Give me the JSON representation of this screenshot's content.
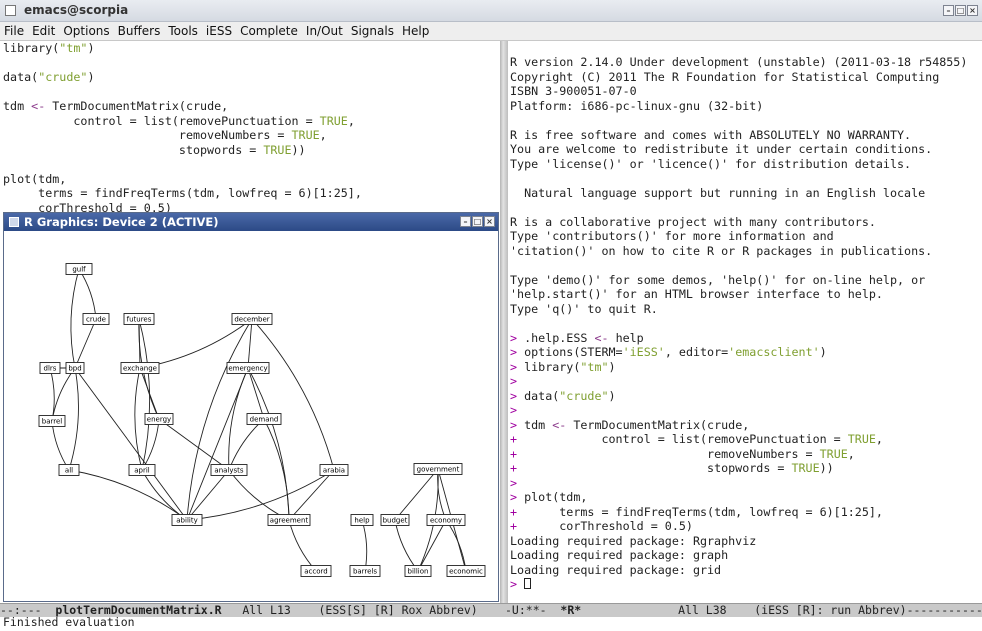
{
  "window": {
    "title": "emacs@scorpia"
  },
  "menu": [
    "File",
    "Edit",
    "Options",
    "Buffers",
    "Tools",
    "iESS",
    "Complete",
    "In/Out",
    "Signals",
    "Help"
  ],
  "editor": {
    "lines": [
      [
        [
          "library(",
          ""
        ],
        [
          "\"tm\"",
          "str"
        ],
        [
          ")",
          ""
        ]
      ],
      [],
      [
        [
          "data(",
          ""
        ],
        [
          "\"crude\"",
          "str"
        ],
        [
          ")",
          ""
        ]
      ],
      [],
      [
        [
          "tdm ",
          ""
        ],
        [
          "<-",
          "op"
        ],
        [
          " TermDocumentMatrix(crude,",
          ""
        ]
      ],
      [
        [
          "          control = list(removePunctuation = ",
          ""
        ],
        [
          "TRUE",
          "str"
        ],
        [
          ",",
          ""
        ]
      ],
      [
        [
          "                         removeNumbers = ",
          ""
        ],
        [
          "TRUE",
          "str"
        ],
        [
          ",",
          ""
        ]
      ],
      [
        [
          "                         stopwords = ",
          ""
        ],
        [
          "TRUE",
          "str"
        ],
        [
          "))",
          ""
        ]
      ],
      [],
      [
        [
          "plot(tdm,",
          ""
        ]
      ],
      [
        [
          "     terms = findFreqTerms(tdm, lowfreq = 6)[1:25],",
          ""
        ]
      ],
      [
        [
          "     corThreshold = 0.5)",
          ""
        ]
      ]
    ]
  },
  "console": {
    "lines": [
      [
        [
          "R version 2.14.0 Under development (unstable) (2011-03-18 r54855)",
          ""
        ]
      ],
      [
        [
          "Copyright (C) 2011 The R Foundation for Statistical Computing",
          ""
        ]
      ],
      [
        [
          "ISBN 3-900051-07-0",
          ""
        ]
      ],
      [
        [
          "Platform: i686-pc-linux-gnu (32-bit)",
          ""
        ]
      ],
      [],
      [
        [
          "R is free software and comes with ABSOLUTELY NO WARRANTY.",
          ""
        ]
      ],
      [
        [
          "You are welcome to redistribute it under certain conditions.",
          ""
        ]
      ],
      [
        [
          "Type 'license()' or 'licence()' for distribution details.",
          ""
        ]
      ],
      [],
      [
        [
          "  Natural language support but running in an English locale",
          ""
        ]
      ],
      [],
      [
        [
          "R is a collaborative project with many contributors.",
          ""
        ]
      ],
      [
        [
          "Type 'contributors()' for more information and",
          ""
        ]
      ],
      [
        [
          "'citation()' on how to cite R or R packages in publications.",
          ""
        ]
      ],
      [],
      [
        [
          "Type 'demo()' for some demos, 'help()' for on-line help, or",
          ""
        ]
      ],
      [
        [
          "'help.start()' for an HTML browser interface to help.",
          ""
        ]
      ],
      [
        [
          "Type 'q()' to quit R.",
          ""
        ]
      ],
      [],
      [
        [
          "> ",
          "pr"
        ],
        [
          ".help.ESS ",
          ""
        ],
        [
          "<-",
          "op"
        ],
        [
          " help",
          ""
        ]
      ],
      [
        [
          "> ",
          "pr"
        ],
        [
          "options(STERM=",
          ""
        ],
        [
          "'iESS'",
          "str"
        ],
        [
          ", editor=",
          ""
        ],
        [
          "'emacsclient'",
          "str"
        ],
        [
          ")",
          ""
        ]
      ],
      [
        [
          "> ",
          "pr"
        ],
        [
          "library(",
          ""
        ],
        [
          "\"tm\"",
          "str"
        ],
        [
          ")",
          ""
        ]
      ],
      [
        [
          ">",
          "pr"
        ]
      ],
      [
        [
          "> ",
          "pr"
        ],
        [
          "data(",
          ""
        ],
        [
          "\"crude\"",
          "str"
        ],
        [
          ")",
          ""
        ]
      ],
      [
        [
          ">",
          "pr"
        ]
      ],
      [
        [
          "> ",
          "pr"
        ],
        [
          "tdm ",
          ""
        ],
        [
          "<-",
          "op"
        ],
        [
          " TermDocumentMatrix(crude,",
          ""
        ]
      ],
      [
        [
          "+ ",
          "pr"
        ],
        [
          "           control = list(removePunctuation = ",
          ""
        ],
        [
          "TRUE",
          "str"
        ],
        [
          ",",
          ""
        ]
      ],
      [
        [
          "+ ",
          "pr"
        ],
        [
          "                          removeNumbers = ",
          ""
        ],
        [
          "TRUE",
          "str"
        ],
        [
          ",",
          ""
        ]
      ],
      [
        [
          "+ ",
          "pr"
        ],
        [
          "                          stopwords = ",
          ""
        ],
        [
          "TRUE",
          "str"
        ],
        [
          "))",
          ""
        ]
      ],
      [
        [
          ">",
          "pr"
        ]
      ],
      [
        [
          "> ",
          "pr"
        ],
        [
          "plot(tdm,",
          ""
        ]
      ],
      [
        [
          "+ ",
          "pr"
        ],
        [
          "     terms = findFreqTerms(tdm, lowfreq = 6)[1:25],",
          ""
        ]
      ],
      [
        [
          "+ ",
          "pr"
        ],
        [
          "     corThreshold = 0.5)",
          ""
        ]
      ],
      [
        [
          "Loading required package: Rgraphviz",
          ""
        ]
      ],
      [
        [
          "Loading required package: graph",
          ""
        ]
      ],
      [
        [
          "Loading required package: grid",
          ""
        ]
      ]
    ],
    "prompt": "> "
  },
  "graphics_window": {
    "title": "R Graphics: Device 2 (ACTIVE)",
    "nodes": [
      "gulf",
      "crude",
      "futures",
      "december",
      "dlrs",
      "bpd",
      "exchange",
      "emergency",
      "energy",
      "demand",
      "barrel",
      "all",
      "april",
      "analysts",
      "arabia",
      "government",
      "ability",
      "agreement",
      "help",
      "budget",
      "economy",
      "accord",
      "barrels",
      "billion",
      "economic"
    ],
    "edges": [
      [
        "gulf",
        "crude"
      ],
      [
        "crude",
        "bpd"
      ],
      [
        "gulf",
        "bpd"
      ],
      [
        "dlrs",
        "barrel"
      ],
      [
        "dlrs",
        "bpd"
      ],
      [
        "bpd",
        "barrel"
      ],
      [
        "bpd",
        "all"
      ],
      [
        "bpd",
        "ability"
      ],
      [
        "barrel",
        "all"
      ],
      [
        "all",
        "ability"
      ],
      [
        "futures",
        "exchange"
      ],
      [
        "futures",
        "energy"
      ],
      [
        "futures",
        "april"
      ],
      [
        "exchange",
        "energy"
      ],
      [
        "exchange",
        "april"
      ],
      [
        "energy",
        "april"
      ],
      [
        "energy",
        "analysts"
      ],
      [
        "april",
        "ability"
      ],
      [
        "december",
        "exchange"
      ],
      [
        "december",
        "emergency"
      ],
      [
        "december",
        "ability"
      ],
      [
        "december",
        "arabia"
      ],
      [
        "emergency",
        "demand"
      ],
      [
        "emergency",
        "analysts"
      ],
      [
        "emergency",
        "agreement"
      ],
      [
        "emergency",
        "ability"
      ],
      [
        "demand",
        "analysts"
      ],
      [
        "demand",
        "agreement"
      ],
      [
        "analysts",
        "ability"
      ],
      [
        "analysts",
        "agreement"
      ],
      [
        "arabia",
        "ability"
      ],
      [
        "arabia",
        "agreement"
      ],
      [
        "agreement",
        "accord"
      ],
      [
        "help",
        "barrels"
      ],
      [
        "government",
        "budget"
      ],
      [
        "government",
        "economy"
      ],
      [
        "government",
        "billion"
      ],
      [
        "government",
        "economic"
      ],
      [
        "budget",
        "billion"
      ],
      [
        "economy",
        "economic"
      ],
      [
        "economy",
        "billion"
      ]
    ]
  },
  "modeline_left": {
    "prefix": "--:---  ",
    "buffer": "plotTermDocumentMatrix.R",
    "rest": "   All L13    (ESS[S] [R] Rox Abbrev)"
  },
  "modeline_right": {
    "prefix": "-U:**-  ",
    "buffer": "*R*",
    "rest": "              All L38    (iESS [R]: run Abbrev)------------"
  },
  "minibuffer": "Finished evaluation"
}
